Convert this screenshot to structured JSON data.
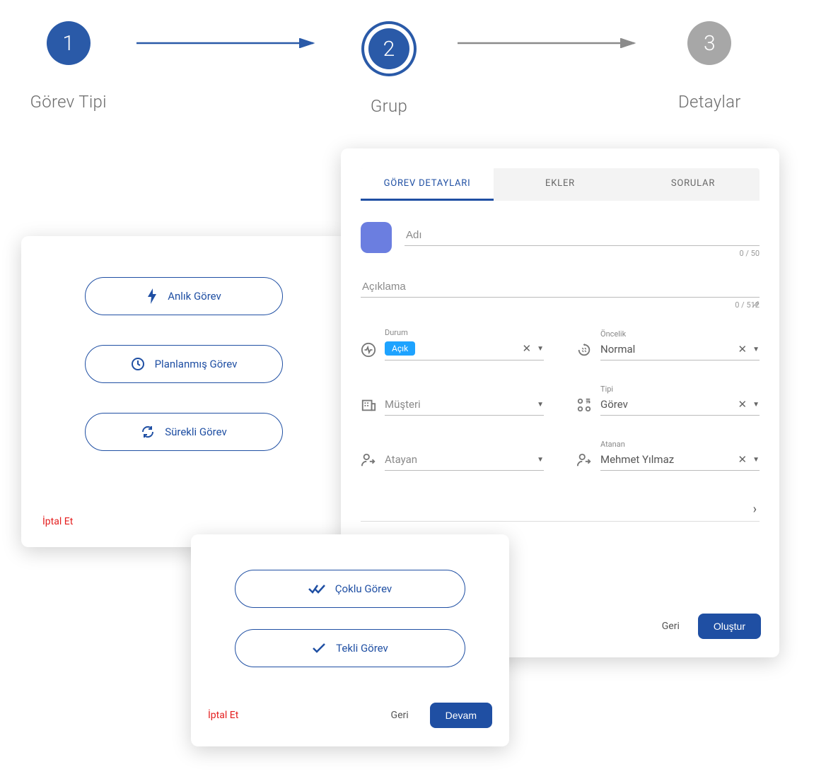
{
  "stepper": {
    "steps": [
      {
        "num": "1",
        "label": "Görev Tipi",
        "state": "done"
      },
      {
        "num": "2",
        "label": "Grup",
        "state": "current"
      },
      {
        "num": "3",
        "label": "Detaylar",
        "state": "pending"
      }
    ]
  },
  "card_task_type": {
    "options": [
      {
        "icon": "bolt-icon",
        "label": "Anlık Görev"
      },
      {
        "icon": "clock-icon",
        "label": "Planlanmış Görev"
      },
      {
        "icon": "refresh-icon",
        "label": "Sürekli Görev"
      }
    ],
    "cancel": "İptal Et"
  },
  "card_group": {
    "options": [
      {
        "icon": "double-check-icon",
        "label": "Çoklu Görev"
      },
      {
        "icon": "check-icon",
        "label": "Tekli Görev"
      }
    ],
    "cancel": "İptal Et",
    "back": "Geri",
    "next": "Devam"
  },
  "card_details": {
    "tabs": [
      {
        "label": "GÖREV DETAYLARI",
        "active": true
      },
      {
        "label": "EKLER",
        "active": false
      },
      {
        "label": "SORULAR",
        "active": false
      }
    ],
    "name": {
      "placeholder": "Adı",
      "value": "",
      "counter": "0 / 50"
    },
    "desc": {
      "placeholder": "Açıklama",
      "value": "",
      "counter": "0 / 512"
    },
    "fields": {
      "durum": {
        "label": "Durum",
        "chip": "Açık",
        "clear": true,
        "caret": true
      },
      "oncelik": {
        "label": "Öncelik",
        "value": "Normal",
        "clear": true,
        "caret": true
      },
      "musteri": {
        "label": "",
        "placeholder": "Müşteri",
        "clear": false,
        "caret": true
      },
      "tipi": {
        "label": "Tipi",
        "value": "Görev",
        "clear": true,
        "caret": true
      },
      "atayan": {
        "label": "",
        "placeholder": "Atayan",
        "clear": false,
        "caret": true
      },
      "atanan": {
        "label": "Atanan",
        "value": "Mehmet Yılmaz",
        "clear": true,
        "caret": true
      }
    },
    "back": "Geri",
    "create": "Oluştur"
  }
}
